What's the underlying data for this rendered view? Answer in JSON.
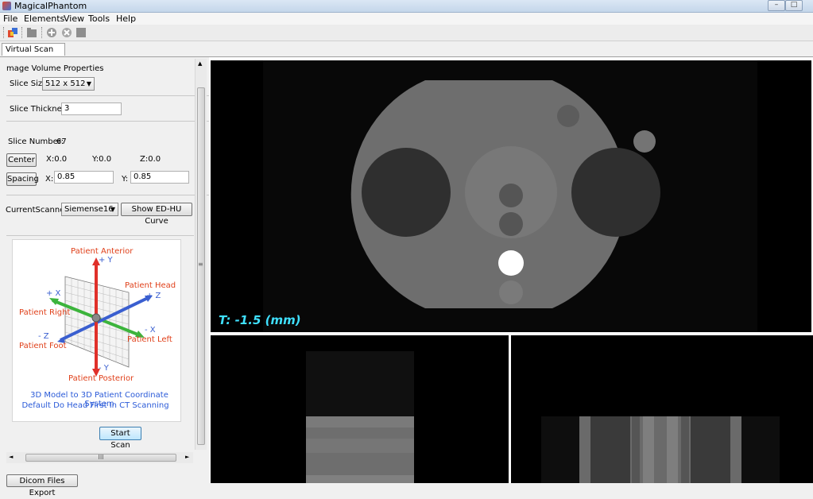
{
  "window": {
    "title": "MagicalPhantom"
  },
  "menu": {
    "file": "File",
    "elements": "Elements",
    "view": "View",
    "tools": "Tools",
    "help": "Help"
  },
  "tabs": {
    "virtual_scan_view": "Virtual Scan View"
  },
  "properties": {
    "section_title": "mage Volume Properties",
    "slice_size_label": "Slice Size:",
    "slice_size_value": "512 x 512",
    "slice_thickness_label": "Slice Thickness:",
    "slice_thickness_value": "3",
    "slice_number_label": "Slice Number:",
    "slice_number_value": "67",
    "center_button": "Center",
    "center_x": "X:0.0",
    "center_y": "Y:0.0",
    "center_z": "Z:0.0",
    "spacing_button": "Spacing",
    "spacing_x_label": "X:",
    "spacing_x_value": "0.85",
    "spacing_y_label": "Y:",
    "spacing_y_value": "0.85",
    "scanner_label": "CurrentScanner:",
    "scanner_value": "Siemense16",
    "show_curve_button": "Show ED-HU Curve"
  },
  "coordinate_figure": {
    "anterior": "Patient Anterior",
    "plus_y": "+ Y",
    "head": "Patient Head",
    "plus_z": "+ Z",
    "plus_x": "+ X",
    "right": "Patient Right",
    "minus_z": "- Z",
    "minus_x": "- X",
    "left": "Patient Left",
    "foot": "Patient Foot",
    "minus_y": "- Y",
    "posterior": "Patient Posterior",
    "caption_line1": "3D Model  to 3D Patient Coordinate  System",
    "caption_line2": "Default Do Head First In  CT Scanning"
  },
  "actions": {
    "start_scan": "Start Scan",
    "dicom_export": "Dicom Files Export"
  },
  "scroll": {
    "h_thumb_grip": "III"
  },
  "viewer": {
    "thickness_overlay": "T:  -1.5   (mm)",
    "overlay_color": "#3fe0ff"
  },
  "colors": {
    "red_axis": "#e0302a",
    "blue_axis": "#3a5fd0",
    "green_axis": "#3cb43c",
    "caption_blue": "#2a5ad8",
    "label_red": "#e0401a"
  }
}
